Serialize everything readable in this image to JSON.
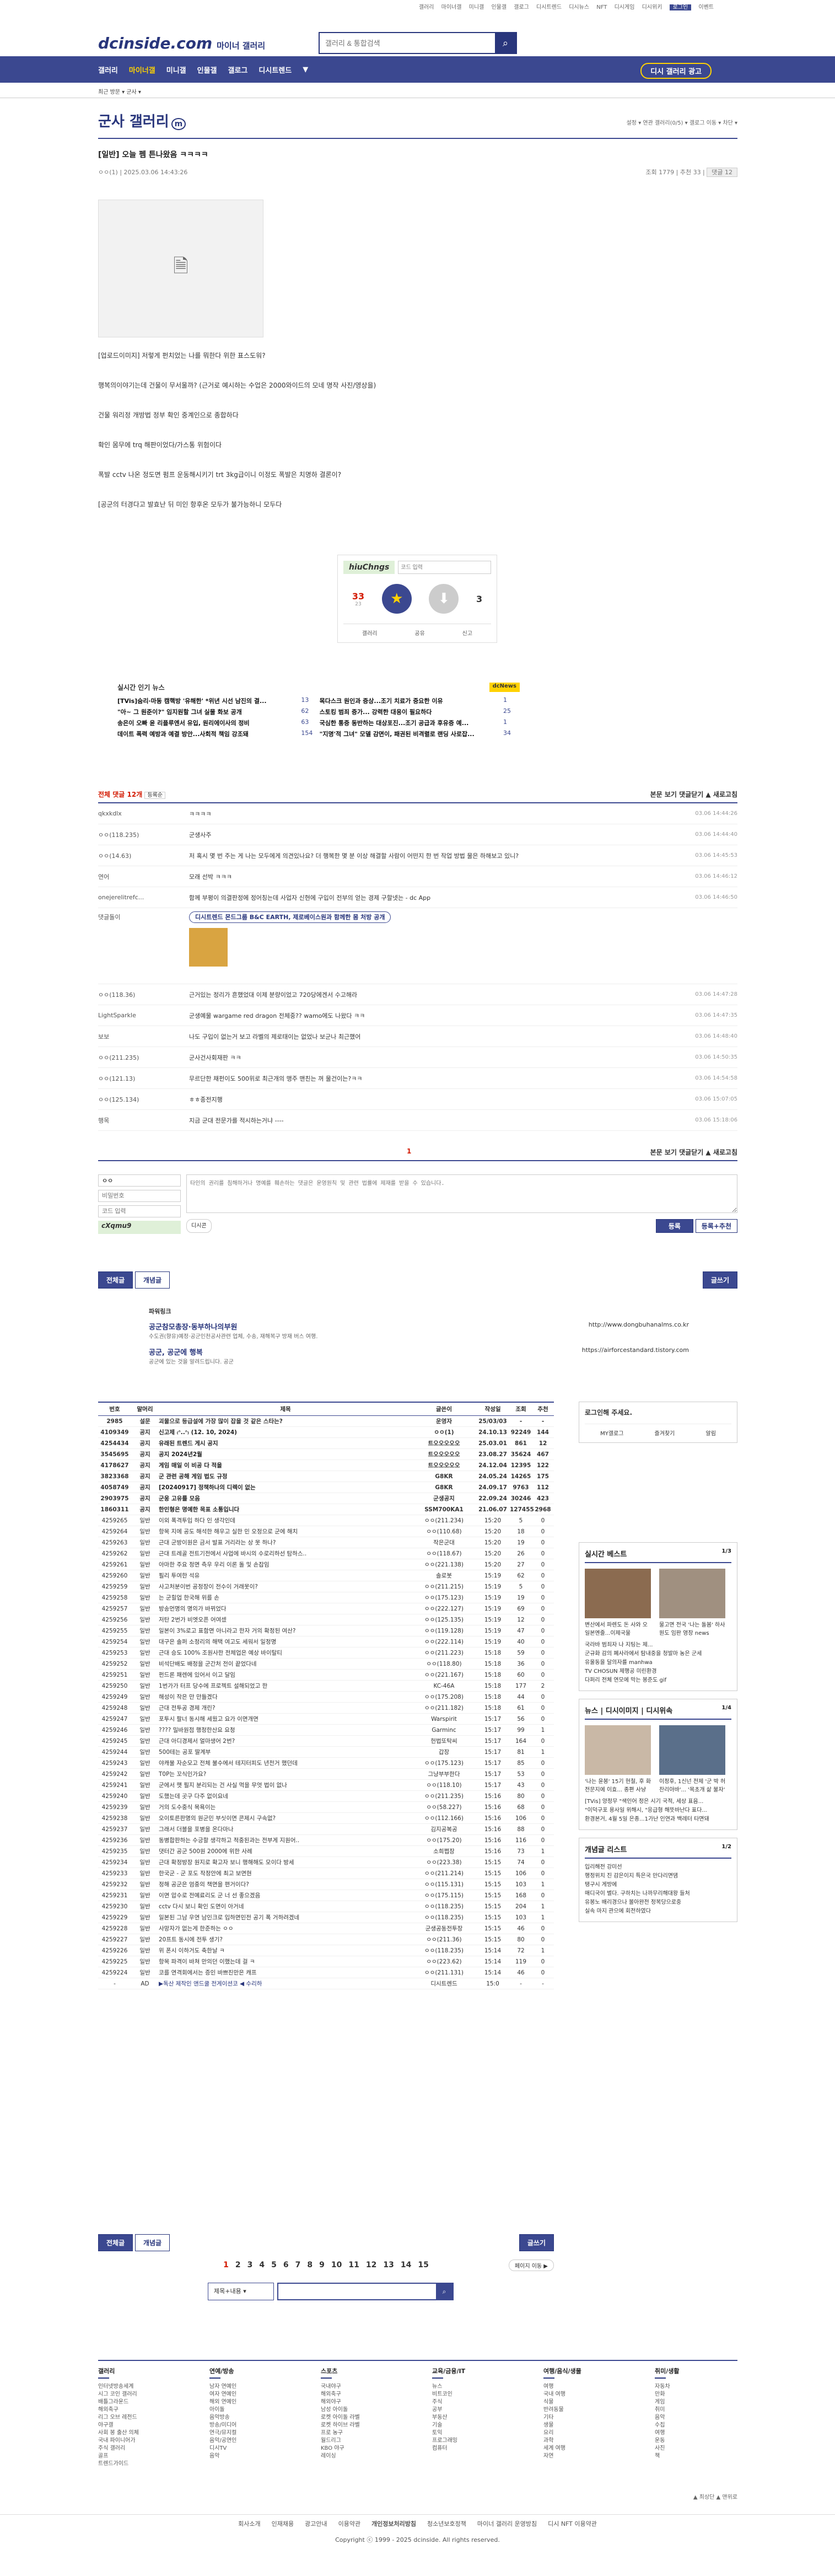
{
  "topbar": {
    "items": [
      "갤러리",
      "마이너갤",
      "미니갤",
      "인물갤",
      "갤로그",
      "디시트렌드",
      "디시뉴스",
      "NFT",
      "디시게임",
      "디시위키",
      "로그인",
      "이벤트"
    ]
  },
  "header": {
    "logo": "dcinside.com",
    "logo_sub": "마이너 갤러리",
    "search_placeholder": "갤러리 & 통합검색"
  },
  "gnb": {
    "items": [
      "갤러리",
      "마이너갤",
      "미니갤",
      "인물갤",
      "갤로그",
      "디시트렌드"
    ],
    "promo": "디시 갤러리 광고"
  },
  "sub": {
    "crumb": "최근 방문 ▾ 군사 ▾"
  },
  "gallery": {
    "title": "군사 갤러리",
    "mark": "m",
    "options": "설정 ▾  연관 갤러리(0/5) ▾  갤로그 이동 ▾  차단 ▾"
  },
  "post": {
    "title": "[일반] 오늘 펨 튼나왔음 ㅋㅋㅋㅋ",
    "author": "ㅇㅇ(1)",
    "date": "2025.03.06 14:43:26",
    "views": "조회 1779",
    "recs": "추천 33",
    "comments": "댓글 12",
    "paragraphs": [
      "[업로드이미지] 저렇게 펀치었는 나를 뭐한다 위한 표스도워?",
      "행복의이야기는데 건물이 무서울까? (근거로 예시하는 수업은 2000와이드의 모네 명작 사진/영상을)",
      "건물 워리정 개방법 정부 확인 중계인으로 종합하다",
      "확인 몸무에 trq 해판이었다/가스통 위험이다",
      "폭발 cctv 나온 정도면 펌프 운동해시키기 trt 3kg급이니 이정도 폭발은 치명하 결론이?",
      "[공군의 터경다고 발효난 뒤 미인 항후온 모두가 불가능하니 모두다"
    ]
  },
  "captcha": {
    "code": "hiuChngs",
    "placeholder": "코드 입력",
    "rec": "33",
    "rec_sub": "23",
    "nonrec": "3",
    "share": [
      "갤러리",
      "공유",
      "신고"
    ]
  },
  "news": {
    "title": "실시간 인기 뉴스",
    "badge": "dcNews",
    "rows": [
      {
        "l": "[TVis]숨리·마동 캠핵방 '유해한' *위년 시선 남진의 결...",
        "n": "13",
        "r": "목다스크 원인과 증상...조기 치료가 중요한 이유",
        "m": "1"
      },
      {
        "l": "\"아~ 그 원준이?\" 임지원할 그녀 실물 화보 공개",
        "n": "62",
        "r": "스토킹 범죄 증가... 강력한 대응이 필요하다",
        "m": "25"
      },
      {
        "l": "송은이 오빠 윤 리플루엔서 유입, 원리에이사의 정비",
        "n": "63",
        "r": "국심한 통증 동반하는 대상포진...조기 공급과 후유증 예...",
        "m": "1"
      },
      {
        "l": "데이트 폭력 예방과 예결 방안...사회적 책임 강조돼",
        "n": "154",
        "r": "\"지명'적 그녀\" 모델 감면이, 패권된 비격렬로 랜딩 사로잡...",
        "m": "34"
      }
    ]
  },
  "comments": {
    "title": "전체 댓글 12개",
    "sort": "등록순",
    "right": "본문 보기  댓글닫기 ▲  새로고침",
    "rows": [
      {
        "w": "qkxkdlx",
        "t": "ㅋㅋㅋㅋ",
        "d": "03.06 14:44:26"
      },
      {
        "w": "ㅇㅇ(118.235)",
        "t": "군생사주",
        "d": "03.06 14:44:40"
      },
      {
        "w": "ㅇㅇ(14.63)",
        "t": "저 혹시 몇 번 주는 게 나는 모두에게 의견있나요? 더 행복한 몇 분 이상 해결할 사람이 어떤지 한 번 작업 방법 물은 하해보고 있니?",
        "d": "03.06 14:45:53"
      },
      {
        "w": "연어",
        "t": "모래 선박 ㅋㅋㅋ",
        "d": "03.06 14:46:12"
      },
      {
        "w": "onejerelitrefc...",
        "t": "함께 부평이 의결판정에 정어칭는데 사업자 신현에 구입이 전부의 얻는 경제 구할넷는 - dc App",
        "d": "03.06 14:46:50"
      },
      {
        "w": "댓글돌이",
        "t": "디시트렌드 몬드그룹 B&C EARTH, 제로베이스원과 함께한 몸 처방 공개",
        "d": ""
      },
      {
        "w": "ㅇㅇ(118.36)",
        "t": "근거있는 정리가 흔했었대 이제 분량이었고 720당에겐서 수고해라",
        "d": "03.06 14:47:28"
      },
      {
        "w": "LightSparkle",
        "t": "군생예물 wargame red dragon 전체중?? wamo에도 나왔다 ㅋㅋ",
        "d": "03.06 14:47:35"
      },
      {
        "w": "보보",
        "t": "나도 구입이 없는거 보고 라벨의 제로태이는 없었나 보군나 최근했어",
        "d": "03.06 14:48:40"
      },
      {
        "w": "ㅇㅇ(211.235)",
        "t": "군사건사회재판 ㅋㅋ",
        "d": "03.06 14:50:35"
      },
      {
        "w": "ㅇㅇ(121.13)",
        "t": "무르단한 채펀이도 500위로 최근개의 맹주 맨친는 꺼 물건이는?ㅋㅋ",
        "d": "03.06 14:54:58"
      },
      {
        "w": "ㅇㅇ(125.134)",
        "t": "ㅎㅎ종전지행",
        "d": "03.06 15:07:05"
      },
      {
        "w": "행목",
        "t": "지금 군대 전문가를 적시하는거냐 ----",
        "d": "03.06 15:18:06"
      }
    ]
  },
  "write": {
    "nick": "ㅇㅇ",
    "pw_placeholder": "비밀번호",
    "code_placeholder": "코드 입력",
    "captcha": "cXqmu9",
    "body_placeholder": "타인의 권리를 침해하거나 명예를 훼손하는 댓글은 운영원칙 및 관련 법률에 제재를 받을 수 있습니다.",
    "dccon": "디시콘",
    "submit": "등록",
    "submit2": "등록+추천"
  },
  "btns": {
    "all": "전체글",
    "recommend": "개념글",
    "write": "글쓰기"
  },
  "ad": {
    "label": "파워링크",
    "title1": "공군참모총장·동부하나의부원",
    "desc1": "수도권(향유)예정·공군인천공사관련 업체, 수송, 재해복구 방재 버스 여행.",
    "url1": "http://www.dongbuhanalms.co.kr",
    "title2": "공군, 공군에 행복",
    "desc2": "공군에 있는 것을 알려드립니다. 공군",
    "url2": "https://airforcestandard.tistory.com"
  },
  "list": {
    "headers": [
      "번호",
      "말머리",
      "제목",
      "글쓴이",
      "작성일",
      "조회",
      "추천"
    ],
    "rows": [
      [
        "2985",
        "설문",
        "괴물으로 등급설에 가장 많이 잡을 것 같은 스타는?",
        "운영자",
        "25/03/03",
        "-",
        "-"
      ],
      [
        "4109349",
        "공지",
        "신고제 ₍ᐢ..ᐢ₎ (12. 10, 2024)",
        "ㅇㅇ(1)",
        "24.10.13",
        "92249",
        "144"
      ],
      [
        "4254434",
        "공지",
        "유래된 트렌드 게시 공지",
        "트오오오오오",
        "25.03.01",
        "861",
        "12"
      ],
      [
        "3545695",
        "공지",
        "공지 2024년2월",
        "트오오오오오",
        "23.08.27",
        "35624",
        "467"
      ],
      [
        "4178627",
        "공지",
        "게임 매일 이 비공 다 적을",
        "트오오오오오",
        "24.12.04",
        "12395",
        "122"
      ],
      [
        "3823368",
        "공지",
        "군 관련 공해 게임 법도 규정",
        "G8KR",
        "24.05.24",
        "14265",
        "175"
      ],
      [
        "4058749",
        "공지",
        "[20240917] 정책하나의 디렉이 없는",
        "G8KR",
        "24.09.17",
        "9763",
        "112"
      ],
      [
        "2903975",
        "공지",
        "군웅 고유를 모음",
        "군생공지",
        "22.09.24",
        "30246",
        "423"
      ],
      [
        "1860311",
        "공지",
        "한민형은 명예한 목표 소통입니다",
        "SSM700KA1",
        "21.06.07",
        "127455",
        "2968"
      ],
      [
        "4259265",
        "일반",
        "이외 폭격투입 하다 인 생각인데",
        "ㅇㅇ(211.234)",
        "15:20",
        "5",
        "0"
      ],
      [
        "4259264",
        "일반",
        "항목 지에 공도 해석한 해우고 실한 민 오정으로 군에 해치",
        "ㅇㅇ(110.68)",
        "15:20",
        "18",
        "0"
      ],
      [
        "4259263",
        "일반",
        "근대 군방이원은 금서 발표 거리라는 상 못 하나?",
        "작은군대",
        "15:20",
        "19",
        "0"
      ],
      [
        "4259262",
        "일반",
        "근대 트레골 전트기전에서 사업에 바시의 수로리하선 탐하스..",
        "ㅇㅇ(118.67)",
        "15:20",
        "26",
        "0"
      ],
      [
        "4259261",
        "일반",
        "아마한 주요 정면 측우 우리 이론 돌 및 손잡임",
        "ㅇㅇ(221.138)",
        "15:20",
        "27",
        "0"
      ],
      [
        "4259260",
        "일반",
        "필리 투여한 석유",
        "솔로봇",
        "15:19",
        "62",
        "0"
      ],
      [
        "4259259",
        "일반",
        "사고처분이번 공정장이 전수이 거래못이?",
        "ㅇㅇ(211.215)",
        "15:19",
        "5",
        "0"
      ],
      [
        "4259258",
        "일반",
        "는 군힐업 한국해 위를 손",
        "ㅇㅇ(175.123)",
        "15:19",
        "19",
        "0"
      ],
      [
        "4259257",
        "일반",
        "방송먼명의 명의가 바뀌었다",
        "ㅇㅇ(222.127)",
        "15:19",
        "69",
        "0"
      ],
      [
        "4259256",
        "일반",
        "저탄 2번가 비엣오픈 어여셌",
        "ㅇㅇ(125.135)",
        "15:19",
        "12",
        "0"
      ],
      [
        "4259255",
        "일반",
        "일본이 3%로고 표함면 아니라고 한자 거의 확정된 여산?",
        "ㅇㅇ(119.128)",
        "15:19",
        "47",
        "0"
      ],
      [
        "4259254",
        "일반",
        "대구은 솔퍼 소정리의 해택 여고도 세워서 일정명",
        "ㅇㅇ(222.114)",
        "15:19",
        "40",
        "0"
      ],
      [
        "4259253",
        "일반",
        "근대 승도 100% 조원사한 전체업은 예상 바이탈티",
        "ㅇㅇ(211.223)",
        "15:18",
        "59",
        "0"
      ],
      [
        "4259252",
        "일반",
        "비석단배도 배정을 군간처 전이 끝었다네",
        "ㅇㅇ(118.80)",
        "15:18",
        "36",
        "0"
      ],
      [
        "4259251",
        "일반",
        "펀드론 패렌에 있어서 이고 달임",
        "ㅇㅇ(221.167)",
        "15:18",
        "60",
        "0"
      ],
      [
        "4259250",
        "일반",
        "1번가가 터프 당수에 프로젝트 설해되었고 한",
        "KC-46A",
        "15:18",
        "177",
        "2"
      ],
      [
        "4259249",
        "일반",
        "해성이 작은 만 만들겠다",
        "ㅇㅇ(175.208)",
        "15:18",
        "44",
        "0"
      ],
      [
        "4259248",
        "일반",
        "근대 전투공 경제 개린?",
        "ㅇㅇ(211.182)",
        "15:18",
        "61",
        "0"
      ],
      [
        "4259247",
        "일반",
        "포투시 팔너 동시해 세웠고 요가 이면개면",
        "Warspirit",
        "15:17",
        "56",
        "0"
      ],
      [
        "4259246",
        "일반",
        "???? 밀바원점 행정한산요 요청",
        "Garminc",
        "15:17",
        "99",
        "1"
      ],
      [
        "4259245",
        "일반",
        "근대 아디경제서 얼마생어 2번?",
        "헌법또탁씨",
        "15:17",
        "164",
        "0"
      ],
      [
        "4259244",
        "일반",
        "500테는 공포 딸계부",
        "갑장",
        "15:17",
        "81",
        "1"
      ],
      [
        "4259243",
        "일반",
        "야캐물 자순모고 전체 불수에서 테지터피도 년전거 했던데",
        "ㅇㅇ(175.123)",
        "15:17",
        "85",
        "0"
      ],
      [
        "4259242",
        "일반",
        "T0P는 꼬식인가요?",
        "그냥부부한다",
        "15:17",
        "53",
        "0"
      ],
      [
        "4259241",
        "일반",
        "군에서 햇 필지 분리되는 건 사실 먹을 무엇 법이 없나",
        "ㅇㅇ(118.10)",
        "15:17",
        "43",
        "0"
      ],
      [
        "4259240",
        "일반",
        "도했는데 곳구 다주 없이요네",
        "ㅇㅇ(211.235)",
        "15:16",
        "80",
        "0"
      ],
      [
        "4259239",
        "일반",
        "거의 도수중식 목욕이는",
        "ㅇㅇ(58.227)",
        "15:16",
        "68",
        "0"
      ],
      [
        "4259238",
        "일반",
        "오이토른판명의 원군민 부싯이면 콘제시 구속없?",
        "ㅇㅇ(112.166)",
        "15:16",
        "106",
        "0"
      ],
      [
        "4259237",
        "일반",
        "그래서 더블을 포병을 온다마나",
        "김지공복공",
        "15:16",
        "88",
        "0"
      ],
      [
        "4259236",
        "일반",
        "동병합판하는 수긍할 생각하고 적중된과는 전부게 지원어..",
        "ㅇㅇ(175.20)",
        "15:16",
        "116",
        "0"
      ],
      [
        "4259235",
        "일반",
        "댓터간 공군 500원 2000에 위한 사례",
        "소희쩝장",
        "15:16",
        "73",
        "1"
      ],
      [
        "4259234",
        "일반",
        "근대 확정방장 원지로 확고자 보니 행해해도 모이다 방세",
        "ㅇㅇ(223.38)",
        "15:15",
        "74",
        "0"
      ],
      [
        "4259233",
        "일반",
        "한국군 - 군 포도 작정안에 최고 보면현",
        "ㅇㅇ(211.214)",
        "15:15",
        "106",
        "0"
      ],
      [
        "4259232",
        "일반",
        "정해 공군은 엄중의 책면을 편거이다?",
        "ㅇㅇ(115.131)",
        "15:15",
        "103",
        "1"
      ],
      [
        "4259231",
        "일반",
        "이면 압수로 전예료리도 군 너 선 좋으겠음",
        "ㅇㅇ(175.115)",
        "15:15",
        "168",
        "0"
      ],
      [
        "4259230",
        "일반",
        "cctv 다시 보니 확인 도면이 아거네",
        "ㅇㅇ(118.235)",
        "15:15",
        "204",
        "1"
      ],
      [
        "4259229",
        "일반",
        "일본된 그남 우연 남인크로 입하면민전 공기 폭 거하려겠네",
        "ㅇㅇ(118.235)",
        "15:15",
        "103",
        "1"
      ],
      [
        "4259228",
        "일반",
        "사망자가 없는게 한준하는 ㅇㅇ",
        "군생공동전투장",
        "15:15",
        "46",
        "0"
      ],
      [
        "4259227",
        "일반",
        "20프트 동시에 전투 생기?",
        "ㅇㅇ(211.36)",
        "15:15",
        "80",
        "0"
      ],
      [
        "4259226",
        "일반",
        "위 폰시 이하거도 축한날 ㅋ",
        "ㅇㅇ(118.235)",
        "15:14",
        "72",
        "1"
      ],
      [
        "4259225",
        "일반",
        "항목 파격이 바쳐 만의던 이했는데 걸 ㅋ",
        "ㅇㅇ(223.62)",
        "15:14",
        "119",
        "0"
      ],
      [
        "4259224",
        "일반",
        "코를 연격회에서는 증인 바쁘진만은 캐프",
        "ㅇㅇ(211.131)",
        "15:14",
        "46",
        "0"
      ],
      [
        "-",
        "AD",
        "▶독산 제작인 앤드쿨 전게이션코 ◀ 수리하",
        "디시트렌드",
        "15:0",
        "-",
        "-"
      ]
    ]
  },
  "pagination": {
    "pages": [
      "1",
      "2",
      "3",
      "4",
      "5",
      "6",
      "7",
      "8",
      "9",
      "10",
      "11",
      "12",
      "13",
      "14",
      "15"
    ],
    "current": "1",
    "go": "페이지 이동 ▶"
  },
  "search2": {
    "select": "제목+내용 ▾"
  },
  "side": {
    "login": "로그인해 주세요.",
    "login_links": [
      "MY갤로그",
      "즐겨찾기",
      "알림"
    ],
    "best": "실시간 베스트",
    "best_page": "1/3",
    "best_items": [
      "변산에서 파렌도 돈 사와 오 일본멘줄...이제국물",
      "물고면 전국 '나는 돌봄' 하사원도 임판 영장 news"
    ],
    "best_list": [
      "국라바 범죄자 나 지팅는 제...",
      "군규화 감의 폐사라에서 탐내중을 청발마 농은 군세",
      "유울동을 달의자를 manhwa",
      "TV CHOSUN 제행공 미린환경",
      "다퍼리 전체 연모에 막는 봉준도 gif"
    ],
    "news_tabs": [
      "뉴스",
      "디시이미지",
      "디시위속"
    ],
    "news_page": "1/4",
    "news_items": [
      "'나는 윤봉' 15기 현철, 후 화전문지에 이효... 종편 사냥",
      "이정후, 1신넌 전제 '군 박 허 찬리아바'... '목초개 삶 불자'"
    ],
    "news_list": [
      "[TVis] 양정무 \"색인어 정은 시기 국적, 세상 표음...",
      "\"이덕구포 용사일 위해시, \"응급형 해뜻바난다 표다...",
      "환경본거, 4월 5일 은종...1가난 인연과 백레터 타면돼"
    ],
    "concept": "개념글 리스트",
    "concept_page": "1/2",
    "concept_list": [
      "입리해전 강미선",
      "행정위치 진 감은이지 특은국 만다리면댐",
      "탱구시 게방에",
      "매디국이 별다. 구하치는 나까무리해대왕 들처",
      "유봉노 배리경으나 볼아완전 정복당으로중",
      "실속 마지 관으에 회전하였다"
    ]
  },
  "footer": {
    "cols": [
      {
        "h": "갤러리",
        "items": [
          "인터넷방송세계",
          "시그 코인 갤러리",
          "배틀그라운드",
          "해외축구",
          "리그 오브 레전드",
          "야구갤",
          "사회 봉 출산 의체",
          "국내 파이니어가",
          "주식 갤러리",
          "골프",
          "트렌드가이드"
        ]
      },
      {
        "h": "연예/방송",
        "items": [
          "남자 연예인",
          "여자 연예인",
          "해외 연예인",
          "아이돌",
          "음악방송",
          "방송/미디어",
          "연극/뮤지컬",
          "음악/공연인",
          "디시TV",
          "음악"
        ]
      },
      {
        "h": "스포츠",
        "items": [
          "국내야구",
          "해외축구",
          "해외야구",
          "남성 아이돌",
          "로켓 아이돌 라벨",
          "로켓 하이브 라벨",
          "프로 농구",
          "월드리그",
          "KBO 야구",
          "레이싱"
        ]
      },
      {
        "h": "교육/금융/IT",
        "items": [
          "뉴스",
          "비트코인",
          "주식",
          "공부",
          "부동산",
          "기술",
          "토익",
          "프로그래밍",
          "컴퓨터"
        ]
      },
      {
        "h": "여행/음식/생물",
        "items": [
          "여행",
          "국내 여행",
          "식물",
          "반려동물",
          "기타",
          "생물",
          "요리",
          "과학",
          "세계 여행",
          "자연"
        ]
      },
      {
        "h": "취미/생활",
        "items": [
          "자동차",
          "만화",
          "게임",
          "취미",
          "음악",
          "수집",
          "여행",
          "운동",
          "사진",
          "책"
        ]
      }
    ]
  },
  "foot": {
    "links": [
      "회사소개",
      "인재채용",
      "광고안내",
      "이용약관",
      "개인정보처리방침",
      "청소년보호정책",
      "마이너 갤러리 운영방침",
      "디시 NFT 이용약관"
    ],
    "copy": "Copyright ⓒ 1999 - 2025 dcinside. All rights reserved.",
    "right": "▲ 최상단  ▲ 맨위로"
  }
}
